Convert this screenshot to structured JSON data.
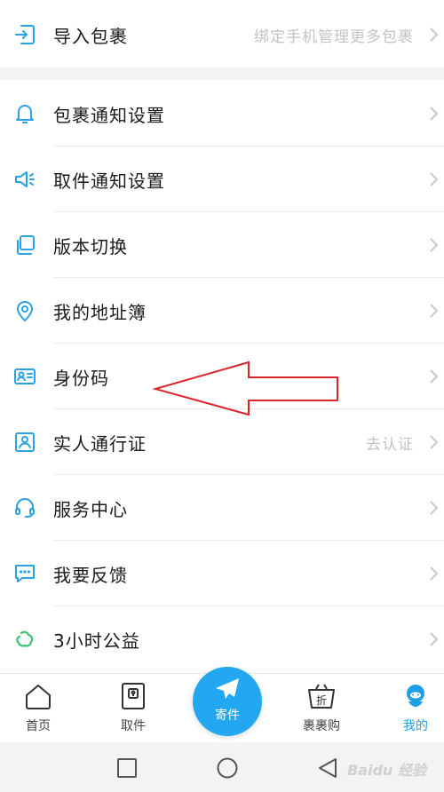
{
  "menu": [
    {
      "label": "导入包裹",
      "hint": "绑定手机管理更多包裹",
      "icon": "import-icon"
    },
    {
      "label": "包裹通知设置",
      "hint": "",
      "icon": "bell-icon"
    },
    {
      "label": "取件通知设置",
      "hint": "",
      "icon": "speaker-icon"
    },
    {
      "label": "版本切换",
      "hint": "",
      "icon": "switch-version-icon"
    },
    {
      "label": "我的地址簿",
      "hint": "",
      "icon": "location-pin-icon"
    },
    {
      "label": "身份码",
      "hint": "",
      "icon": "id-card-icon"
    },
    {
      "label": "实人通行证",
      "hint": "去认证",
      "icon": "person-badge-icon"
    },
    {
      "label": "服务中心",
      "hint": "",
      "icon": "headset-icon"
    },
    {
      "label": "我要反馈",
      "hint": "",
      "icon": "feedback-bubble-icon"
    },
    {
      "label": "3小时公益",
      "hint": "",
      "icon": "charity-leaf-icon"
    }
  ],
  "tabs": {
    "home": "首页",
    "pickup": "取件",
    "send": "寄件",
    "shop": "裹裹购",
    "mine": "我的"
  },
  "shop_badge": "折",
  "watermark": "Baidu 经验",
  "colors": {
    "accent": "#22a7f0",
    "icon": "#2aa2e4",
    "annotation_arrow": "#d9262b"
  }
}
